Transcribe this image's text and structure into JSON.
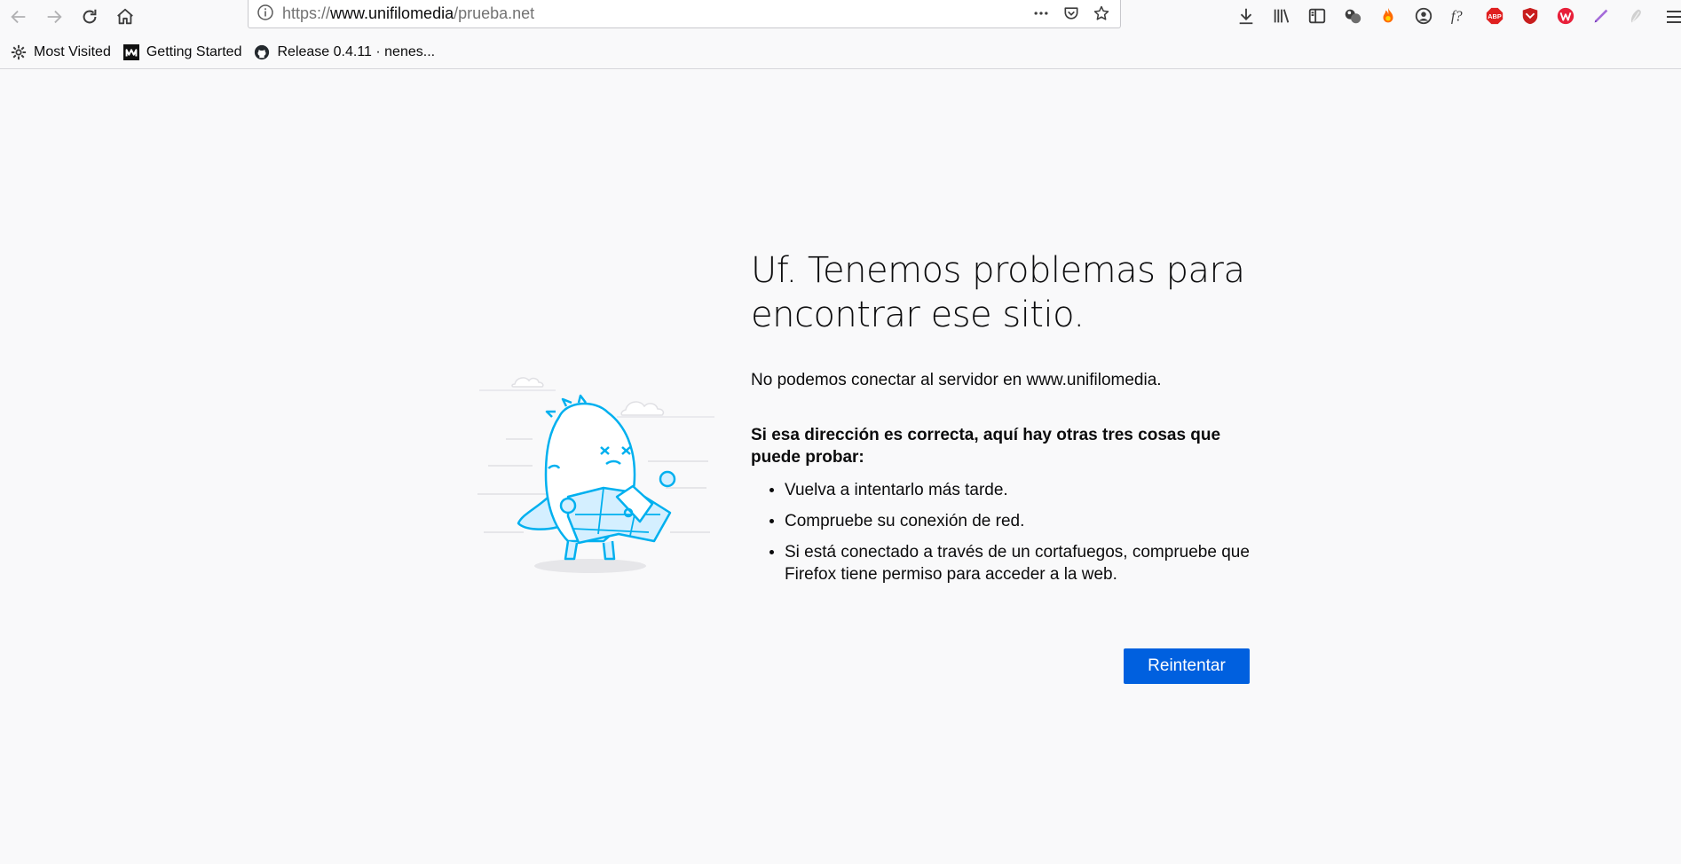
{
  "browser": {
    "url": {
      "prefix": "https://",
      "host": "www.unifilomedia",
      "suffix": "/prueba.net"
    },
    "bookmarks": [
      {
        "label": "Most Visited",
        "icon": "gear-icon"
      },
      {
        "label": "Getting Started",
        "icon": "medium-logo-icon"
      },
      {
        "label": "Release 0.4.11 · nenes...",
        "icon": "github-icon"
      }
    ],
    "extensions": [
      "download-icon",
      "library-icon",
      "sidebar-icon",
      "containers-icon",
      "fire-icon",
      "account-icon",
      "fx-icon",
      "adblock-icon",
      "shield-icon",
      "w-icon",
      "pen-icon",
      "pen-grey-icon"
    ],
    "fx_label": "f?",
    "abp_label": "ABP"
  },
  "error_page": {
    "title": "Uf. Tenemos problemas para encontrar ese sitio.",
    "description": "No podemos conectar al servidor en www.unifilomedia.",
    "advice_heading": "Si esa dirección es correcta, aquí hay otras tres cosas que puede probar:",
    "tips": [
      "Vuelva a intentarlo más tarde.",
      "Compruebe su conexión de red.",
      "Si está conectado a través de un cortafuegos, compruebe que Firefox tiene permiso para acceder a la web."
    ],
    "retry_label": "Reintentar"
  },
  "colors": {
    "accent": "#0060df",
    "background": "#f9f9fa",
    "illustration": "#00b0ef"
  }
}
